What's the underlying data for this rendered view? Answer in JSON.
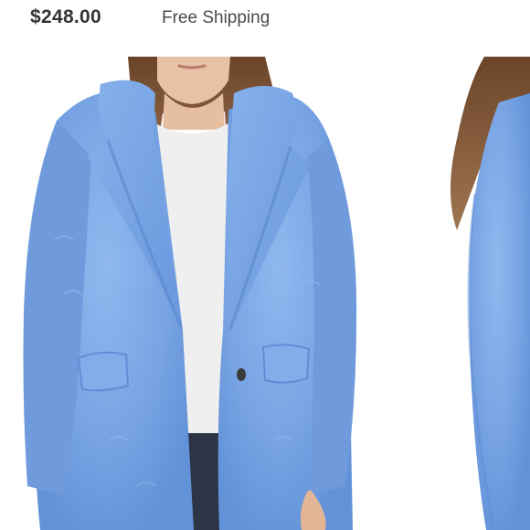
{
  "listing": {
    "price": "$248.00",
    "shipping": "Free Shipping"
  },
  "gallery": {
    "main_image": "blue-faux-fur-coat-front-view",
    "side_image": "blue-faux-fur-coat-side-view-partial"
  },
  "colors": {
    "coat_blue": "#7aa7e6",
    "coat_shadow": "#5f8dd6",
    "sweater": "#efefef",
    "hair": "#7b5233",
    "skin": "#e8c2a6",
    "jeans": "#2c3446"
  }
}
